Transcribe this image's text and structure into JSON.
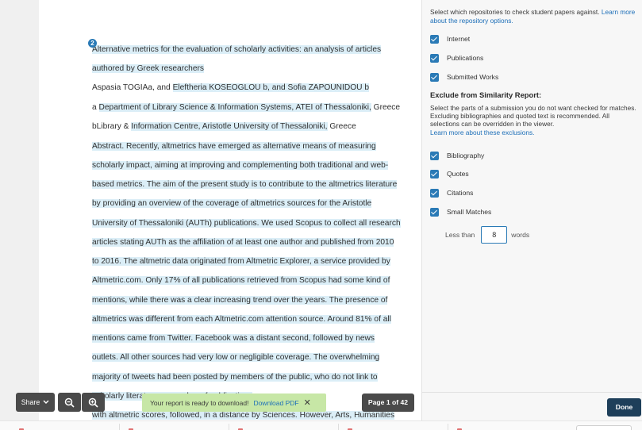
{
  "document": {
    "footnote_marker": "2",
    "lines": [
      {
        "hl": "Alternative metrics for the evaluation of scholarly activities: an analysis of articles"
      },
      {
        "hl": "authored by Greek researchers"
      },
      {
        "pre": "Aspasia TOGIAa, and ",
        "hl": "Eleftheria KOSEOGLOU b, and Sofia ZAPOUNIDOU b"
      },
      {
        "pre": "a ",
        "hl": "Department of Library Science & Information Systems, ATEI of Thessaloniki,",
        "post": " Greece"
      },
      {
        "pre": "bLibrary & ",
        "hl": "Information Centre, Aristotle University of Thessaloniki,",
        "post": " Greece"
      },
      {
        "hl": "Abstract. Recently, altmetrics have emerged as alternative means of measuring"
      },
      {
        "hl": "scholarly impact, aiming at improving and complementing both traditional and web-"
      },
      {
        "hl": "based metrics. The aim of the present study is to contribute to the altmetrics literature"
      },
      {
        "hl": "by providing an overview of the coverage of altmetrics sources for the Aristotle"
      },
      {
        "hl": "University of Thessaloniki (AUTh) publications. We used Scopus to collect all research"
      },
      {
        "hl": "articles stating AUTh as the affiliation of at least one author and published from 2010"
      },
      {
        "hl": "to 2016. The altmetric data originated from Altmetric Explorer, a service provided by"
      },
      {
        "hl": "Altmetric.com. Only 17% of all publications retrieved from Scopus had some kind of"
      },
      {
        "hl": "mentions, while there was a clear increasing trend over the years. The presence of"
      },
      {
        "hl": "altmetrics was different from each Altmetric.com attention source. Around 81% of all"
      },
      {
        "hl": "mentions came from Twitter. Facebook was a distant second, followed by news"
      },
      {
        "hl": "outlets. All other sources had very low or negligible coverage. The overwhelming"
      },
      {
        "hl": "majority of tweets had been posted by members of the public, who do not link to"
      },
      {
        "hl": "scholarly literature. ... number of publications"
      },
      {
        "hl": "with altmetric scores, followed, in a distance by Sciences. However, Arts, Humanities"
      }
    ]
  },
  "panel": {
    "repos_intro_1": "Select which repositories to check student papers against.",
    "repos_intro_link_1": " Learn more",
    "repos_intro_link_2": "about the repository options.",
    "repositories": [
      "Internet",
      "Publications",
      "Submitted Works"
    ],
    "exclude_heading": "Exclude from Similarity Report:",
    "exclude_desc_1": "Select the parts of a submission you do not want checked for matches.",
    "exclude_desc_2": "Excluding bibliographies and quoted text is recommended. All",
    "exclude_desc_3": "selections can be overridden in the viewer.",
    "exclude_link": "Learn more about these exclusions.",
    "exclusions": [
      "Bibliography",
      "Quotes",
      "Citations",
      "Small Matches"
    ],
    "less_than_label": "Less than",
    "words_value": "8",
    "words_label": "words",
    "done_label": "Done"
  },
  "toolbar": {
    "share_label": "Share",
    "toast_text": "Your report is ready to download!",
    "toast_link": "Download PDF",
    "toast_close": "✕",
    "page_indicator": "Page 1 of 42"
  },
  "colors": {
    "accent": "#2a7ab6",
    "highlight": "#dbeef7",
    "toast": "#c7e7a6",
    "done": "#1e3f5a"
  }
}
